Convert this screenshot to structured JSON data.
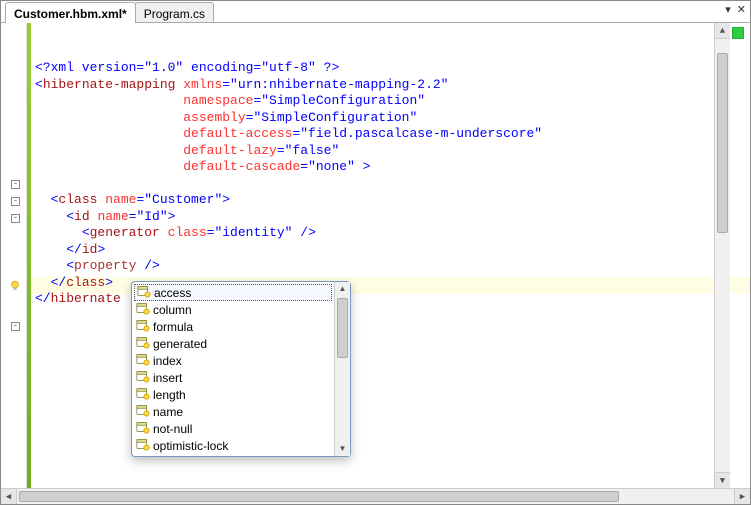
{
  "tabs": [
    {
      "label": "Customer.hbm.xml*",
      "active": true
    },
    {
      "label": "Program.cs",
      "active": false
    }
  ],
  "code": {
    "l1_decl": "<?xml version=\"1.0\" encoding=\"utf-8\" ?>",
    "l2_open": "<",
    "l2_tag": "hibernate-mapping",
    "l2_a1n": " xmlns",
    "l2_a1v": "=\"urn:nhibernate-mapping-2.2\"",
    "l3_an": "namespace",
    "l3_av": "=\"SimpleConfiguration\"",
    "l4_an": "assembly",
    "l4_av": "=\"SimpleConfiguration\"",
    "l5_an": "default-access",
    "l5_av": "=\"field.pascalcase-m-underscore\"",
    "l6_an": "default-lazy",
    "l6_av": "=\"false\"",
    "l7_an": "default-cascade",
    "l7_av": "=\"none\"",
    "l7_close": " >",
    "l8_open": "<",
    "l8_tag": "class",
    "l8_an": " name",
    "l8_av": "=\"Customer\"",
    "l8_close": ">",
    "l9_open": "<",
    "l9_tag": "id",
    "l9_an": " name",
    "l9_av": "=\"Id\"",
    "l9_close": ">",
    "l10_open": "<",
    "l10_tag": "generator",
    "l10_an": " class",
    "l10_av": "=\"identity\"",
    "l10_close": " />",
    "l11": "</",
    "l11_tag": "id",
    "l11_close": ">",
    "l12_open": "<",
    "l12_tag": "property",
    "l12_close": " />",
    "l13": "</",
    "l13_tag": "class",
    "l13_close": ">",
    "l14": "</",
    "l14_tag": "hibernate",
    "l14_close": ""
  },
  "intellisense": {
    "items": [
      "access",
      "column",
      "formula",
      "generated",
      "index",
      "insert",
      "length",
      "name",
      "not-null",
      "optimistic-lock"
    ],
    "selected_index": 0
  },
  "controls": {
    "dropdown": "▾",
    "close": "✕"
  }
}
